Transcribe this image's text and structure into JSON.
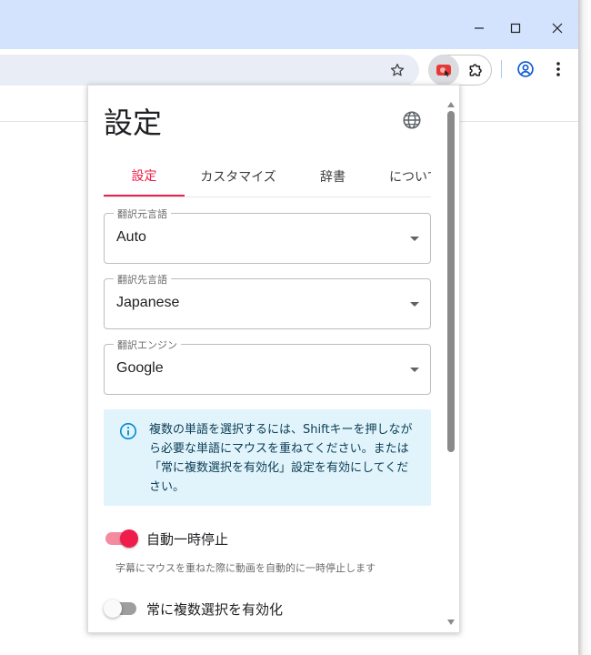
{
  "window": {
    "minimize_icon": "minimize-icon",
    "maximize_icon": "maximize-icon",
    "close_icon": "close-icon"
  },
  "toolbar": {
    "bookmark_icon": "star-icon",
    "extension_active_icon": "extension-active-icon",
    "extensions_icon": "puzzle-icon",
    "profile_icon": "profile-icon",
    "menu_icon": "kebab-menu-icon"
  },
  "popup": {
    "title": "設定",
    "language_icon": "globe-icon",
    "tabs": [
      {
        "label": "設定",
        "active": true
      },
      {
        "label": "カスタマイズ",
        "active": false
      },
      {
        "label": "辞書",
        "active": false
      },
      {
        "label": "について",
        "active": false
      }
    ],
    "fields": [
      {
        "label": "翻訳元言語",
        "value": "Auto"
      },
      {
        "label": "翻訳先言語",
        "value": "Japanese"
      },
      {
        "label": "翻訳エンジン",
        "value": "Google"
      }
    ],
    "info": {
      "icon": "info-icon",
      "text": "複数の単語を選択するには、Shiftキーを押しながら必要な単語にマウスを重ねてください。または「常に複数選択を有効化」設定を有効にしてください。"
    },
    "toggles": [
      {
        "label": "自動一時停止",
        "on": true,
        "description": "字幕にマウスを重ねた際に動画を自動的に一時停止します"
      },
      {
        "label": "常に複数選択を有効化",
        "on": false
      }
    ]
  },
  "colors": {
    "accent": "#ee1d4b",
    "titlebar": "#d3e3fd",
    "info_bg": "#e1f4fb",
    "info_text": "#0b3d56"
  }
}
